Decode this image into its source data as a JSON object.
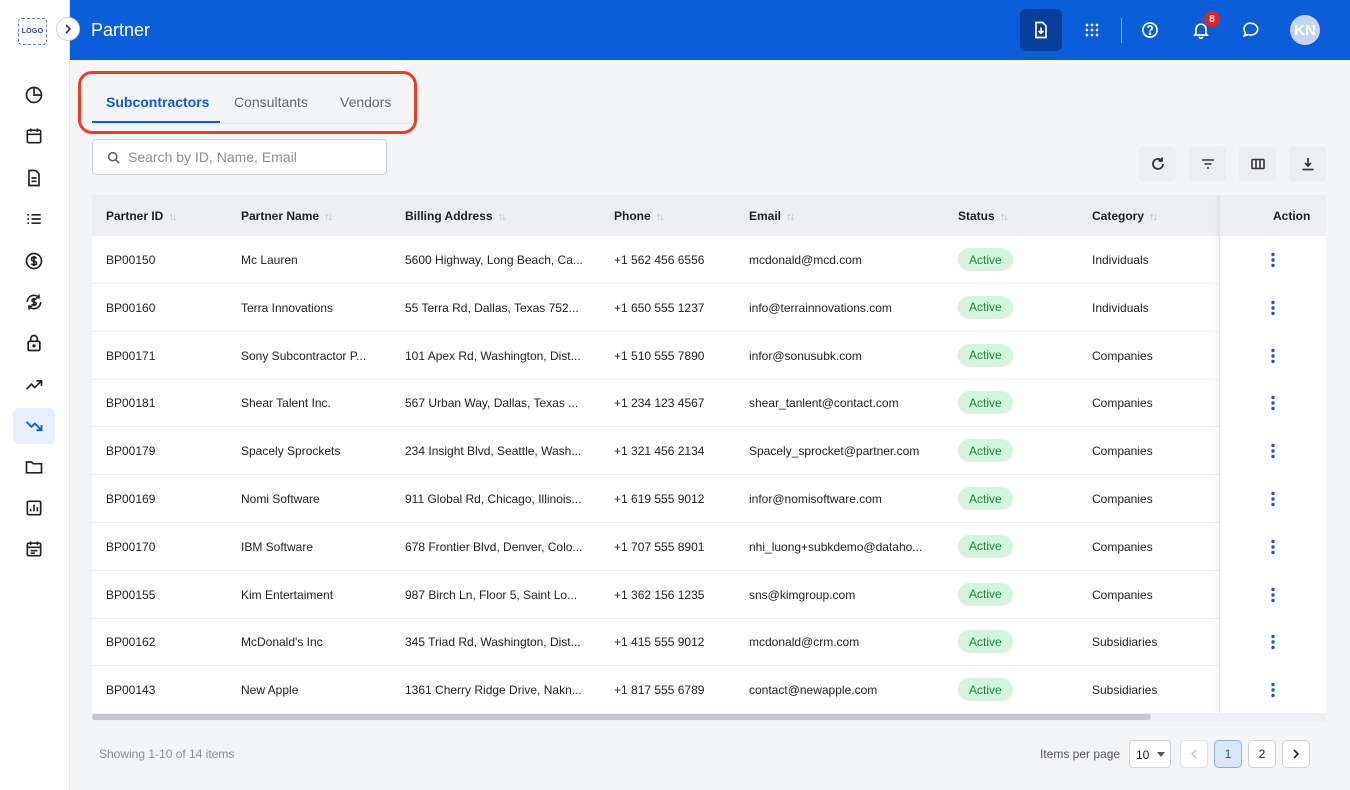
{
  "sidebar": {
    "logo_text": "LOGO",
    "items": [
      {
        "icon": "pie-chart-icon"
      },
      {
        "icon": "calendar-icon"
      },
      {
        "icon": "document-icon"
      },
      {
        "icon": "list-icon"
      },
      {
        "icon": "dollar-icon"
      },
      {
        "icon": "dollar-refresh-icon"
      },
      {
        "icon": "lock-icon"
      },
      {
        "icon": "trending-up-icon"
      },
      {
        "icon": "trending-down-icon",
        "active": true
      },
      {
        "icon": "folder-icon"
      },
      {
        "icon": "bar-report-icon"
      },
      {
        "icon": "calendar-list-icon"
      }
    ]
  },
  "header": {
    "title": "Partner",
    "notification_count": "8",
    "avatar_initials": "KN"
  },
  "tabs": [
    {
      "label": "Subcontractors",
      "active": true
    },
    {
      "label": "Consultants"
    },
    {
      "label": "Vendors"
    }
  ],
  "search": {
    "placeholder": "Search by ID, Name, Email",
    "value": ""
  },
  "table": {
    "columns": [
      "Partner ID",
      "Partner Name",
      "Billing Address",
      "Phone",
      "Email",
      "Status",
      "Category"
    ],
    "action_header": "Action",
    "rows": [
      {
        "id": "BP00150",
        "name": "Mc Lauren",
        "address": "5600 Highway, Long Beach, Ca...",
        "phone": "+1 562 456 6556",
        "email": "mcdonald@mcd.com",
        "status": "Active",
        "category": "Individuals"
      },
      {
        "id": "BP00160",
        "name": "Terra Innovations",
        "address": "55 Terra Rd, Dallas, Texas 752...",
        "phone": "+1 650 555 1237",
        "email": "info@terrainnovations.com",
        "status": "Active",
        "category": "Individuals"
      },
      {
        "id": "BP00171",
        "name": "Sony Subcontractor P...",
        "address": "101 Apex Rd, Washington, Dist...",
        "phone": "+1 510 555 7890",
        "email": "infor@sonusubk.com",
        "status": "Active",
        "category": "Companies"
      },
      {
        "id": "BP00181",
        "name": "Shear Talent Inc.",
        "address": "567 Urban Way, Dallas, Texas ...",
        "phone": "+1 234 123 4567",
        "email": "shear_tanlent@contact.com",
        "status": "Active",
        "category": "Companies"
      },
      {
        "id": "BP00179",
        "name": "Spacely Sprockets",
        "address": "234 Insight Blvd, Seattle, Wash...",
        "phone": "+1 321 456 2134",
        "email": "Spacely_sprocket@partner.com",
        "status": "Active",
        "category": "Companies"
      },
      {
        "id": "BP00169",
        "name": "Nomi Software",
        "address": "911 Global Rd, Chicago, Illinois...",
        "phone": "+1 619 555 9012",
        "email": "infor@nomisoftware.com",
        "status": "Active",
        "category": "Companies"
      },
      {
        "id": "BP00170",
        "name": "IBM Software",
        "address": "678 Frontier Blvd, Denver, Colo...",
        "phone": "+1 707 555 8901",
        "email": "nhi_luong+subkdemo@dataho...",
        "status": "Active",
        "category": "Companies"
      },
      {
        "id": "BP00155",
        "name": "Kim Entertaiment",
        "address": "987 Birch Ln, Floor 5, Saint Lo...",
        "phone": "+1 362 156 1235",
        "email": "sns@kimgroup.com",
        "status": "Active",
        "category": "Companies"
      },
      {
        "id": "BP00162",
        "name": "McDonald's Inc",
        "address": "345 Triad Rd, Washington, Dist...",
        "phone": "+1 415 555 9012",
        "email": "mcdonald@crm.com",
        "status": "Active",
        "category": "Subsidiaries"
      },
      {
        "id": "BP00143",
        "name": "New Apple",
        "address": "1361 Cherry Ridge Drive, Nakn...",
        "phone": "+1 817 555 6789",
        "email": "contact@newapple.com",
        "status": "Active",
        "category": "Subsidiaries"
      }
    ]
  },
  "footer": {
    "showing": "Showing 1-10 of 14 items",
    "items_per_page_label": "Items per page",
    "items_per_page": "10",
    "pages": [
      "1",
      "2"
    ],
    "current_page": "1"
  },
  "colors": {
    "primary": "#0b5ed7",
    "active_status_bg": "#d4f5dc",
    "active_status_text": "#1a8a3a",
    "highlight": "#ef3b24"
  }
}
